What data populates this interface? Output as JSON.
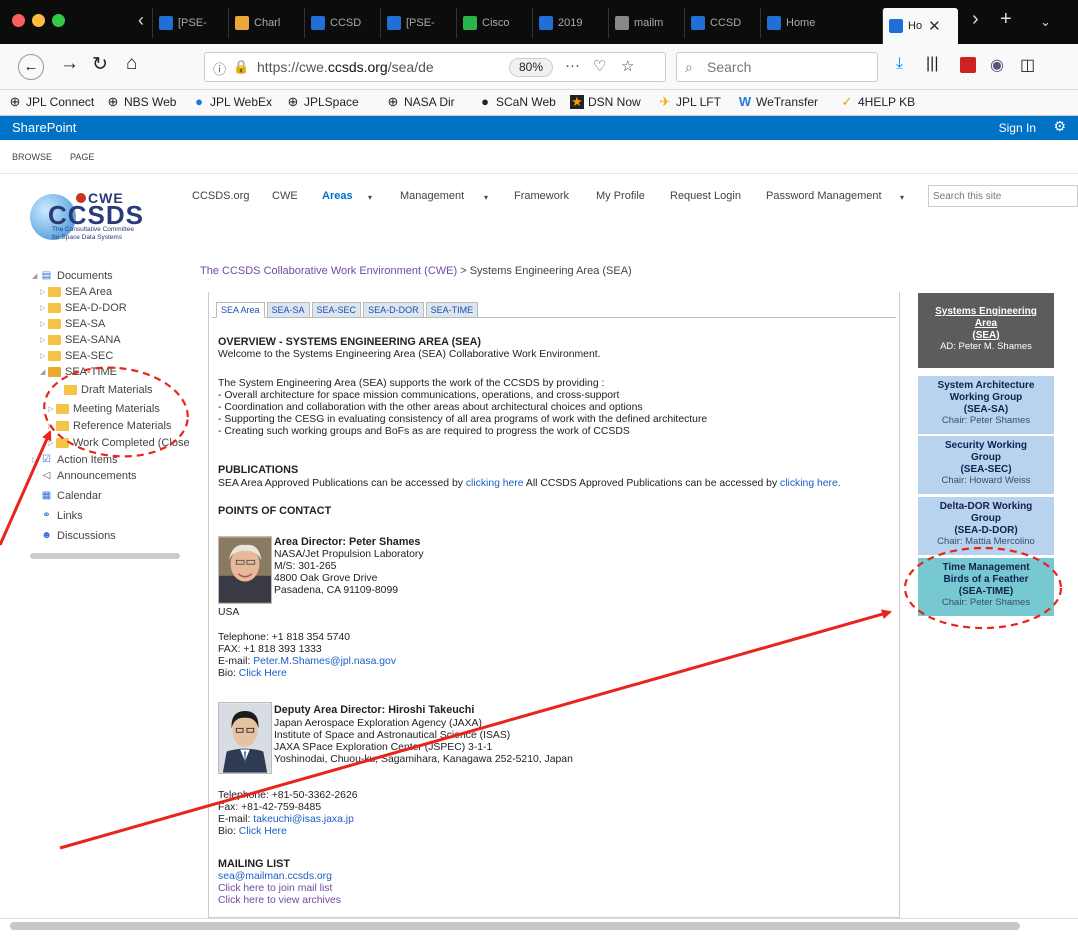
{
  "browser": {
    "tabs": [
      {
        "label": "[PSE-",
        "color": "#1f6fd6"
      },
      {
        "label": "Charl",
        "color": "#e8a93a"
      },
      {
        "label": "CCSD",
        "color": "#1f6fd6"
      },
      {
        "label": "[PSE-",
        "color": "#1f6fd6"
      },
      {
        "label": "Cisco",
        "color": "#2ab34a"
      },
      {
        "label": "2019",
        "color": "#1f6fd6"
      },
      {
        "label": "mailm",
        "color": "#888888"
      },
      {
        "label": "CCSD",
        "color": "#1f6fd6"
      },
      {
        "label": "Home",
        "color": "#1f6fd6"
      },
      {
        "label": "Ho",
        "color": "#1f6fd6"
      }
    ],
    "url_prefix": "https://cwe.",
    "url_domain": "ccsds.org",
    "url_path": "/sea/de",
    "zoom": "80%",
    "search_placeholder": "Search",
    "bookmarks": [
      "JPL Connect",
      "NBS Web",
      "JPL WebEx",
      "JPLSpace",
      "NASA Dir",
      "SCaN Web",
      "DSN Now",
      "JPL LFT",
      "WeTransfer",
      "4HELP KB"
    ]
  },
  "sharepoint": {
    "brand": "SharePoint",
    "sign_in": "Sign In",
    "ribbon": [
      "BROWSE",
      "PAGE"
    ]
  },
  "logo": {
    "cwe": "CWE",
    "ccsds": "CCSDS",
    "sub1": "The Consultative Committee",
    "sub2": "for Space Data Systems"
  },
  "topnav": [
    "CCSDS.org",
    "CWE",
    "Areas",
    "Management",
    "Framework",
    "My Profile",
    "Request Login",
    "Password Management"
  ],
  "site_search_placeholder": "Search this site",
  "tree": [
    "Documents",
    "SEA Area",
    "SEA-D-DOR",
    "SEA-SA",
    "SEA-SANA",
    "SEA-SEC",
    "SEA-TIME",
    "Draft Materials",
    "Meeting Materials",
    "Reference Materials",
    "Work Completed (Close",
    "Action Items",
    "Announcements",
    "Calendar",
    "Links",
    "Discussions"
  ],
  "breadcrumb": {
    "link": "The CCSDS Collaborative Work Environment (CWE)",
    "current": " > Systems Engineering Area (SEA)"
  },
  "content_tabs": [
    "SEA Area",
    "SEA-SA",
    "SEA-SEC",
    "SEA-D-DOR",
    "SEA-TIME"
  ],
  "overview": {
    "title": "OVERVIEW - SYSTEMS ENGINEERING AREA (SEA)",
    "welcome": "Welcome to the Systems Engineering Area (SEA) Collaborative Work Environment.",
    "intro": "The System Engineering Area (SEA) supports the work of the CCSDS by providing :",
    "bullets": [
      "- Overall architecture for space mission communications, operations, and cross-support",
      "- Coordination and collaboration with the other areas about architectural choices and options",
      "- Supporting the CESG in evaluating consistency of all area programs of work with the defined architecture",
      "- Creating such working groups and BoFs as are required to progress the work of CCSDS"
    ]
  },
  "publications": {
    "title": "PUBLICATIONS",
    "t1": "SEA Area Approved Publications can be accessed by ",
    "l1": "clicking here",
    "t2": " All CCSDS Approved Publications can be accessed by ",
    "l2": "clicking here."
  },
  "poc": {
    "title": "POINTS OF CONTACT",
    "ad": {
      "name": "Area Director: Peter Shames",
      "lines": [
        "NASA/Jet Propulsion Laboratory",
        "M/S: 301-265",
        "4800 Oak Grove Drive",
        "Pasadena, CA 91109-8099"
      ],
      "country": "USA",
      "tel": "Telephone: +1 818 354 5740",
      "fax": "FAX: +1 818 393 1333",
      "email_label": "E-mail: ",
      "email": "Peter.M.Shames@jpl.nasa.gov",
      "bio_label": "Bio: ",
      "bio": "Click Here"
    },
    "dad": {
      "name": "Deputy Area Director: Hiroshi Takeuchi",
      "lines": [
        "Japan Aerospace Exploration Agency (JAXA)",
        "Institute of Space and Astronautical Science (ISAS)",
        "JAXA SPace Exploration Center (JSPEC) 3-1-1",
        "Yoshinodai, Chuou-ku, Sagamihara, Kanagawa 252-5210, Japan"
      ],
      "tel": "Telephone: +81-50-3362-2626",
      "fax": "Fax: +81-42-759-8485",
      "email_label": "E-mail: ",
      "email": "takeuchi@isas.jaxa.jp",
      "bio_label": "Bio: ",
      "bio": "Click Here"
    }
  },
  "mailing": {
    "title": "MAILING LIST",
    "email": "sea@mailman.ccsds.org",
    "join": "Click here to join mail list",
    "archives": "Click here to view archives"
  },
  "sidebar": {
    "area": {
      "t1": "Systems Engineering",
      "t2": "Area",
      "t3": "(SEA)",
      "c": "AD: Peter M. Shames"
    },
    "groups": [
      {
        "t1": "System Architecture",
        "t2": "Working Group",
        "t3": "(SEA-SA)",
        "c": "Chair: Peter Shames"
      },
      {
        "t1": "Security Working",
        "t2": "Group",
        "t3": "(SEA-SEC)",
        "c": "Chair: Howard Weiss"
      },
      {
        "t1": "Delta-DOR Working",
        "t2": "Group",
        "t3": "(SEA-D-DOR)",
        "c": "Chair: Mattia Mercolino"
      },
      {
        "t1": "Time Management",
        "t2": "Birds of a Feather",
        "t3": "(SEA-TIME)",
        "c": "Chair: Peter Shames"
      }
    ]
  },
  "colors": {
    "accent": "#0072c6",
    "annotation": "#e8241b"
  }
}
